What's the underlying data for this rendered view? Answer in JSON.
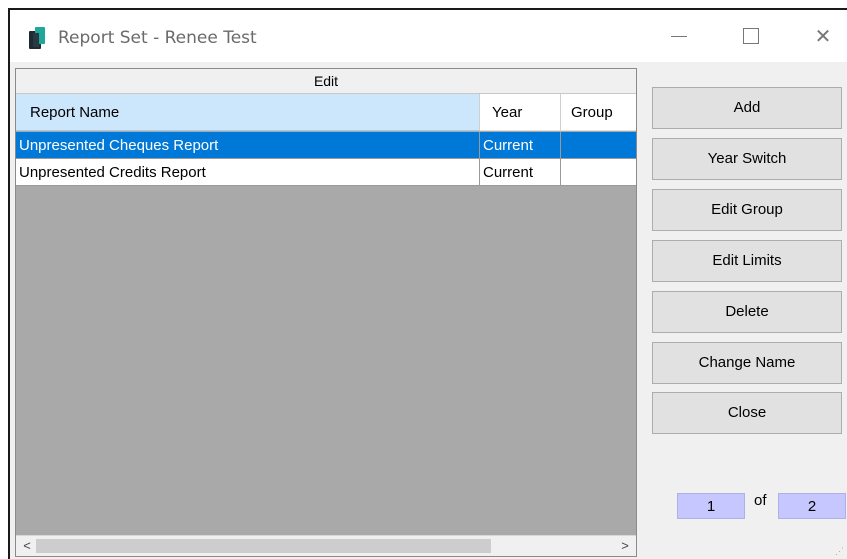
{
  "window": {
    "title": "Report Set - Renee Test",
    "controls": {
      "minimize": "—",
      "maximize": "☐",
      "close": "✕"
    }
  },
  "grid": {
    "caption": "Edit",
    "columns": [
      "Report Name",
      "Year",
      "Group"
    ],
    "rows": [
      {
        "name": "Unpresented Cheques Report",
        "year": "Current",
        "group": "",
        "selected": true
      },
      {
        "name": "Unpresented Credits Report",
        "year": "Current",
        "group": "",
        "selected": false
      }
    ],
    "scroll": {
      "left": "<",
      "right": ">"
    }
  },
  "buttons": {
    "add": "Add",
    "year_switch": "Year Switch",
    "edit_group": "Edit Group",
    "edit_limits": "Edit Limits",
    "delete": "Delete",
    "change_name": "Change Name",
    "close": "Close"
  },
  "pager": {
    "current": "1",
    "of_label": "of",
    "total": "2"
  },
  "colors": {
    "selected_row": "#0078d7",
    "header_highlight": "#cce6fb",
    "grid_background": "#a9a9a9",
    "pager_box": "#c7c7ff",
    "app_icon": "#1fa89a"
  }
}
